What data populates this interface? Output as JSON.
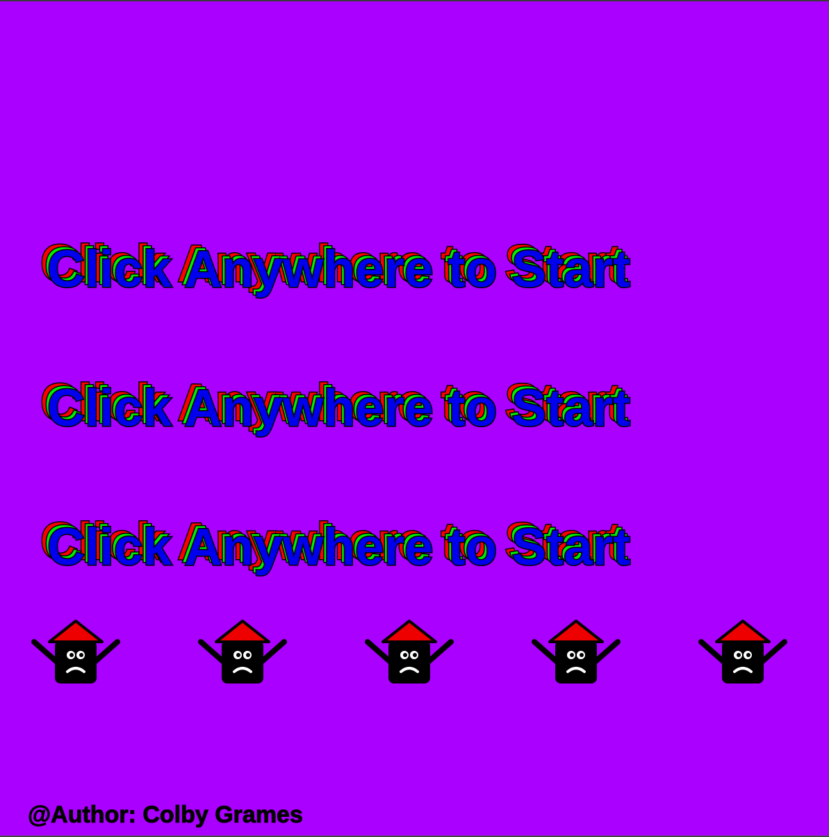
{
  "start_screen": {
    "prompts": [
      "Click Anywhere to Start",
      "Click Anywhere to Start",
      "Click Anywhere to Start"
    ],
    "author_credit": "@Author: Colby Grames"
  },
  "characters": [
    {
      "icon": "worried-block-character-icon"
    },
    {
      "icon": "worried-block-character-icon"
    },
    {
      "icon": "worried-block-character-icon"
    },
    {
      "icon": "worried-block-character-icon"
    },
    {
      "icon": "worried-block-character-icon"
    }
  ],
  "colors": {
    "background": "#aa00ff",
    "text_red": "#ff0000",
    "text_green": "#00ee00",
    "text_blue": "#0000ee",
    "hat": "#ee0000",
    "body": "#000000"
  }
}
